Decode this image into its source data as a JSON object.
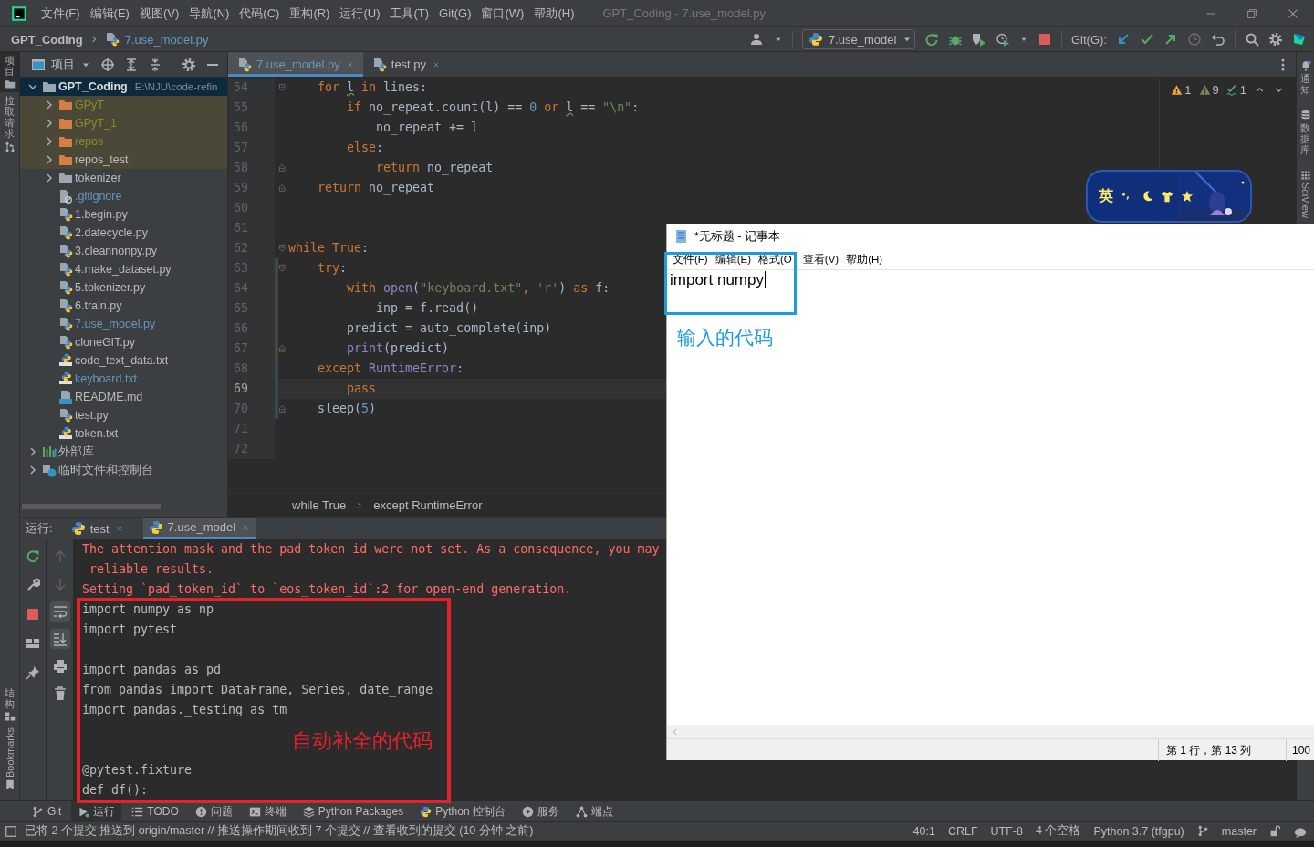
{
  "title_bar": {
    "menu": [
      "文件(F)",
      "编辑(E)",
      "视图(V)",
      "导航(N)",
      "代码(C)",
      "重构(R)",
      "运行(U)",
      "工具(T)",
      "Git(G)",
      "窗口(W)",
      "帮助(H)"
    ],
    "title": "GPT_Coding - 7.use_model.py"
  },
  "nav_bar": {
    "project": "GPT_Coding",
    "file": "7.use_model.py",
    "run_config": "7.use_model",
    "git_label": "Git(G):"
  },
  "left_stripe": {
    "top": [
      {
        "label": "项目",
        "selected": true
      },
      {
        "label": "拉取请求",
        "selected": false
      }
    ],
    "bottom": [
      {
        "label": "结构",
        "selected": false
      },
      {
        "label": "Bookmarks",
        "selected": false
      }
    ]
  },
  "right_stripe": [
    {
      "label": "通知"
    },
    {
      "label": "数据库"
    },
    {
      "label": "SciView"
    }
  ],
  "project_panel": {
    "title": "项目",
    "tree": [
      {
        "name": "GPT_Coding",
        "path": "E:\\NJU\\code-refin",
        "kind": "project",
        "expanded": true,
        "selected": true,
        "children": [
          {
            "name": "GPyT",
            "kind": "folder-excluded",
            "color": "#8d8b2b",
            "highlighted": true,
            "expanded": false
          },
          {
            "name": "GPyT_1",
            "kind": "folder-excluded",
            "color": "#8d8b2b",
            "highlighted": true,
            "expanded": false
          },
          {
            "name": "repos",
            "kind": "folder-excluded",
            "color": "#8d8b2b",
            "highlighted": true,
            "expanded": false
          },
          {
            "name": "repos_test",
            "kind": "folder-excluded",
            "color": "#bbbbbb",
            "highlighted": true,
            "expanded": false
          },
          {
            "name": "tokenizer",
            "kind": "folder",
            "color": "#bbbbbb",
            "highlighted": false,
            "expanded": false
          },
          {
            "name": ".gitignore",
            "kind": "gitignore",
            "color": "#6897bb"
          },
          {
            "name": "1.begin.py",
            "kind": "python",
            "color": "#bbbbbb"
          },
          {
            "name": "2.datecycle.py",
            "kind": "python",
            "color": "#bbbbbb"
          },
          {
            "name": "3.cleannonpy.py",
            "kind": "python",
            "color": "#bbbbbb"
          },
          {
            "name": "4.make_dataset.py",
            "kind": "python",
            "color": "#bbbbbb"
          },
          {
            "name": "5.tokenizer.py",
            "kind": "python",
            "color": "#bbbbbb"
          },
          {
            "name": "6.train.py",
            "kind": "python",
            "color": "#bbbbbb"
          },
          {
            "name": "7.use_model.py",
            "kind": "python",
            "color": "#6897bb"
          },
          {
            "name": "cloneGIT.py",
            "kind": "python",
            "color": "#bbbbbb"
          },
          {
            "name": "code_text_data.txt",
            "kind": "text",
            "color": "#bbbbbb"
          },
          {
            "name": "keyboard.txt",
            "kind": "text",
            "color": "#6897bb"
          },
          {
            "name": "README.md",
            "kind": "markdown",
            "color": "#bbbbbb"
          },
          {
            "name": "test.py",
            "kind": "python",
            "color": "#bbbbbb"
          },
          {
            "name": "token.txt",
            "kind": "text",
            "color": "#bbbbbb"
          }
        ]
      },
      {
        "name": "外部库",
        "kind": "library",
        "expanded": false,
        "selected": false
      },
      {
        "name": "临时文件和控制台",
        "kind": "scratch",
        "expanded": false,
        "selected": false
      }
    ]
  },
  "editor": {
    "tabs": [
      {
        "label": "7.use_model.py",
        "selected": true,
        "color": "#6897bb"
      },
      {
        "label": "test.py",
        "selected": false,
        "color": "#bbbbbb"
      }
    ],
    "lines": [
      {
        "number": "54",
        "fold_start": true,
        "segments": [
          {
            "kind": "kw",
            "text": "    for "
          },
          {
            "kind": "typo",
            "text": "l"
          },
          {
            "kind": "kw",
            "text": " in "
          },
          {
            "kind": "id",
            "text": "lines:"
          }
        ]
      },
      {
        "number": "55",
        "segments": [
          {
            "kind": "kw",
            "text": "        if "
          },
          {
            "kind": "id",
            "text": "no_repeat.count(l) == "
          },
          {
            "kind": "num",
            "text": "0"
          },
          {
            "kind": "kw",
            "text": " or "
          },
          {
            "kind": "typo",
            "text": "l"
          },
          {
            "kind": "id",
            "text": " == "
          },
          {
            "kind": "str",
            "text": "\"\\n\""
          },
          {
            "kind": "id",
            "text": ":"
          }
        ]
      },
      {
        "number": "56",
        "segments": [
          {
            "kind": "id",
            "text": "            no_repeat += l"
          }
        ]
      },
      {
        "number": "57",
        "segments": [
          {
            "kind": "kw",
            "text": "        else"
          },
          {
            "kind": "id",
            "text": ":"
          }
        ]
      },
      {
        "number": "58",
        "fold_end": true,
        "segments": [
          {
            "kind": "kw",
            "text": "            return "
          },
          {
            "kind": "id",
            "text": "no_repeat"
          }
        ]
      },
      {
        "number": "59",
        "fold_end": true,
        "segments": [
          {
            "kind": "kw",
            "text": "    return "
          },
          {
            "kind": "id",
            "text": "no_repeat"
          }
        ]
      },
      {
        "number": "60"
      },
      {
        "number": "61"
      },
      {
        "number": "62",
        "fold_start": true,
        "segments": [
          {
            "kind": "kw",
            "text": "while True"
          },
          {
            "kind": "id",
            "text": ":"
          }
        ]
      },
      {
        "number": "63",
        "fold_start": true,
        "color": "#384c38",
        "segments": [
          {
            "kind": "kw",
            "text": "    try"
          },
          {
            "kind": "id",
            "text": ":"
          }
        ]
      },
      {
        "number": "64",
        "color": "#4a4536",
        "segments": [
          {
            "kind": "kw",
            "text": "        with "
          },
          {
            "kind": "builtin",
            "text": "open"
          },
          {
            "kind": "id",
            "text": "("
          },
          {
            "kind": "str",
            "text": "\"keyboard.txt\""
          },
          {
            "kind": "kw",
            "text": ", "
          },
          {
            "kind": "str",
            "text": "'r'"
          },
          {
            "kind": "id",
            "text": ") "
          },
          {
            "kind": "kw",
            "text": "as "
          },
          {
            "kind": "id",
            "text": "f:"
          }
        ]
      },
      {
        "number": "65",
        "color": "#4a4536",
        "segments": [
          {
            "kind": "id",
            "text": "            inp = f.read()"
          }
        ]
      },
      {
        "number": "66",
        "color": "#4a4536",
        "segments": [
          {
            "kind": "id",
            "text": "        predict = auto_complete(inp)"
          }
        ]
      },
      {
        "number": "67",
        "fold_end": true,
        "color": "#4a4536",
        "segments": [
          {
            "kind": "builtin",
            "text": "        print"
          },
          {
            "kind": "id",
            "text": "(predict)"
          }
        ]
      },
      {
        "number": "68",
        "color": "#374752",
        "segments": [
          {
            "kind": "kw",
            "text": "    except "
          },
          {
            "kind": "builtin",
            "text": "RuntimeError"
          },
          {
            "kind": "id",
            "text": ":"
          }
        ]
      },
      {
        "number": "69",
        "current": true,
        "color": "#374752",
        "segments": [
          {
            "kind": "kw",
            "text": "        pass"
          }
        ]
      },
      {
        "number": "70",
        "fold_end": true,
        "color": "#374752",
        "segments": [
          {
            "kind": "id",
            "text": "    sleep("
          },
          {
            "kind": "num",
            "text": "5"
          },
          {
            "kind": "id",
            "text": ")"
          }
        ]
      },
      {
        "number": "71"
      },
      {
        "number": "72"
      }
    ],
    "inspections": [
      {
        "kind": "warning",
        "count": "1"
      },
      {
        "kind": "weak",
        "count": "9"
      },
      {
        "kind": "typo",
        "count": "1"
      }
    ],
    "breadcrumb": [
      "while True",
      "except RuntimeError"
    ]
  },
  "run_panel": {
    "label": "运行:",
    "tabs": [
      {
        "label": "test",
        "selected": false
      },
      {
        "label": "7.use_model",
        "selected": true
      }
    ],
    "output": [
      {
        "kind": "stderr",
        "text": "The attention mask and the pad token id were not set. As a consequence, you may"
      },
      {
        "kind": "stderr",
        "text": " reliable results."
      },
      {
        "kind": "stderr",
        "text": "Setting `pad_token_id` to `eos_token_id`:2 for open-end generation."
      },
      {
        "kind": "stdout",
        "text": "import numpy as np"
      },
      {
        "kind": "stdout",
        "text": "import pytest"
      },
      {
        "kind": "blank"
      },
      {
        "kind": "stdout",
        "text": "import pandas as pd"
      },
      {
        "kind": "stdout",
        "text": "from pandas import DataFrame, Series, date_range"
      },
      {
        "kind": "stdout",
        "text": "import pandas._testing as tm"
      },
      {
        "kind": "blank"
      },
      {
        "kind": "blank"
      },
      {
        "kind": "stdout",
        "text": "@pytest.fixture"
      },
      {
        "kind": "stdout",
        "text": "def df():"
      }
    ]
  },
  "notepad": {
    "title": "*无标题 - 记事本",
    "menu": [
      "文件(F)",
      "编辑(E)",
      "格式(O",
      "查看(V)",
      "帮助(H)"
    ],
    "text": "import numpy",
    "status": [
      "第 1 行，第 13 列",
      "100"
    ]
  },
  "ime_toolbar": {
    "label": "英"
  },
  "annotations": [
    {
      "label": "输入的代码",
      "color": "#1e9be0"
    },
    {
      "label": "自动补全的代码",
      "color": "#e8202a"
    }
  ],
  "tool_windows": [
    {
      "label": "Git",
      "selected": false
    },
    {
      "label": "运行",
      "selected": true
    },
    {
      "label": "TODO",
      "selected": false
    },
    {
      "label": "问题",
      "selected": false
    },
    {
      "label": "终端",
      "selected": false
    },
    {
      "label": "Python Packages",
      "selected": false
    },
    {
      "label": "Python 控制台",
      "selected": false
    },
    {
      "label": "服务",
      "selected": false
    },
    {
      "label": "端点",
      "selected": false
    }
  ],
  "status_bar": {
    "message": "已将 2 个提交 推送到 origin/master // 推送操作期间收到 7 个提交 // 查看收到的提交 (10 分钟 之前)",
    "items": [
      "40:1",
      "CRLF",
      "UTF-8",
      "4 个空格",
      "Python 3.7 (tfgpu)",
      "master"
    ]
  }
}
